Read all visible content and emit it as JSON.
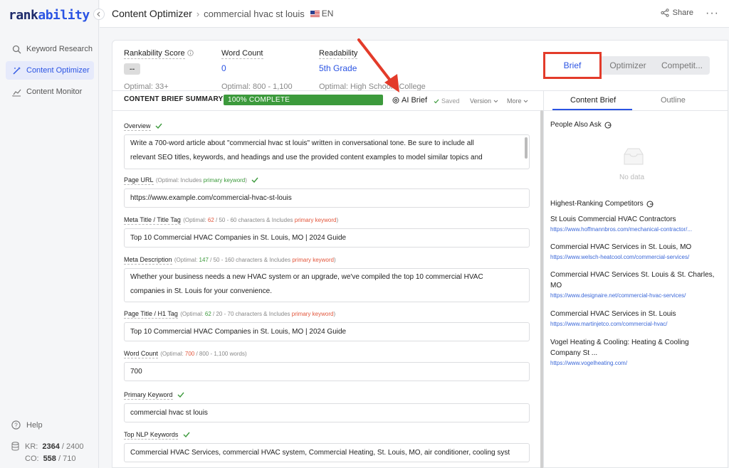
{
  "app": {
    "logo_prefix": "rank",
    "logo_suffix": "ability"
  },
  "sidebar": {
    "items": [
      {
        "label": "Keyword Research",
        "icon": "search-icon",
        "active": false
      },
      {
        "label": "Content Optimizer",
        "icon": "wand-icon",
        "active": true
      },
      {
        "label": "Content Monitor",
        "icon": "chart-line-icon",
        "active": false
      }
    ],
    "help": "Help",
    "credits": [
      {
        "prefix": "KR:",
        "used": "2364",
        "total": "/ 2400"
      },
      {
        "prefix": "CO:",
        "used": "558",
        "total": "/ 710"
      }
    ]
  },
  "header": {
    "title": "Content Optimizer",
    "separator": "›",
    "keyword": "commercial hvac st louis",
    "lang": "EN",
    "share": "Share"
  },
  "metrics": {
    "score": {
      "label": "Rankability Score",
      "value": "--",
      "optimal": "Optimal: 33+"
    },
    "wordcount": {
      "label": "Word Count",
      "value": "0",
      "optimal": "Optimal: 800 - 1,100"
    },
    "readability": {
      "label": "Readability",
      "value": "5th Grade",
      "optimal": "Optimal: High School / College"
    }
  },
  "view_tabs": {
    "brief": "Brief",
    "optimizer": "Optimizer",
    "competitors": "Competit..."
  },
  "summary": {
    "title": "CONTENT BRIEF SUMMARY",
    "progress_label": "100% COMPLETE",
    "progress_fraction": 1.0,
    "ai_brief": "AI Brief",
    "saved": "Saved",
    "version": "Version",
    "more": "More"
  },
  "fields": {
    "overview": {
      "label": "Overview",
      "value_line1": "Write a 700-word article about \"commercial hvac st louis\" written in conversational tone. Be sure to include all",
      "value_line2": "relevant SEO titles, keywords, and headings and use the provided content examples to model similar topics and"
    },
    "page_url": {
      "label": "Page URL",
      "hint_pre": "(Optimal: Includes ",
      "hint_kw": "primary keyword",
      "hint_post": ")",
      "value": "https://www.example.com/commercial-hvac-st-louis"
    },
    "meta_title": {
      "label": "Meta Title / Title Tag",
      "hint_pre": "(Optimal: ",
      "hint_num": "62",
      "hint_mid": " / 50 - 60 characters & Includes ",
      "hint_kw": "primary keyword",
      "hint_post": ")",
      "value": "Top 10 Commercial HVAC Companies in St. Louis, MO | 2024 Guide"
    },
    "meta_desc": {
      "label": "Meta Description",
      "hint_pre": "(Optimal: ",
      "hint_num": "147",
      "hint_mid": " / 50 - 160 characters & Includes ",
      "hint_kw": "primary keyword",
      "hint_post": ")",
      "value_line1": "Whether your business needs a new HVAC system or an upgrade, we've compiled the top 10 commercial HVAC",
      "value_line2": "companies in St. Louis for your convenience."
    },
    "h1": {
      "label": "Page Title / H1 Tag",
      "hint_pre": "(Optimal: ",
      "hint_num": "62",
      "hint_mid": " / 20 - 70 characters & Includes ",
      "hint_kw": "primary keyword",
      "hint_post": ")",
      "value": "Top 10 Commercial HVAC Companies in St. Louis, MO | 2024 Guide"
    },
    "word_count": {
      "label": "Word Count",
      "hint_pre": "(Optimal: ",
      "hint_num": "700",
      "hint_post": " / 800 - 1,100 words)",
      "value": "700"
    },
    "primary_kw": {
      "label": "Primary Keyword",
      "value": "commercial hvac st louis"
    },
    "nlp": {
      "label": "Top NLP Keywords",
      "value": "Commercial HVAC Services, commercial HVAC system, Commercial Heating, St. Louis, MO, air conditioner, cooling syst"
    }
  },
  "right_panel": {
    "tab_brief": "Content Brief",
    "tab_outline": "Outline",
    "paa_title": "People Also Ask",
    "no_data": "No data",
    "competitors_title": "Highest-Ranking Competitors",
    "competitors": [
      {
        "title": "St Louis Commercial HVAC Contractors",
        "url": "https://www.hoffmannbros.com/mechanical-contractor/..."
      },
      {
        "title": "Commercial HVAC Services in St. Louis, MO",
        "url": "https://www.welsch-heatcool.com/commercial-services/"
      },
      {
        "title": "Commercial HVAC Services St. Louis & St. Charles, MO",
        "url": "https://www.designaire.net/commercial-hvac-services/"
      },
      {
        "title": "Commercial HVAC Services in St. Louis",
        "url": "https://www.martinjetco.com/commercial-hvac/"
      },
      {
        "title": "Vogel Heating & Cooling: Heating & Cooling Company St ...",
        "url": "https://www.vogelheating.com/"
      }
    ]
  },
  "colors": {
    "accent": "#2b54e3",
    "progress": "#3c9a3c",
    "annotation": "#e33b2a"
  }
}
